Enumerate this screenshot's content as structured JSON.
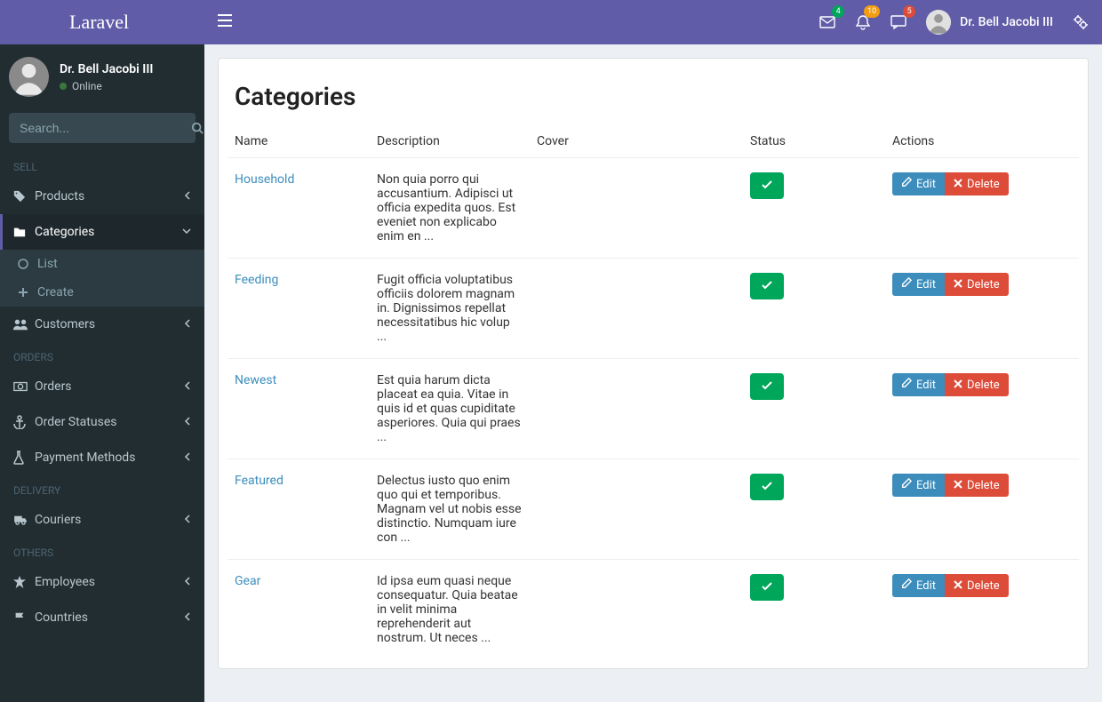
{
  "brand": "Laravel",
  "user": {
    "name": "Dr. Bell Jacobi III",
    "status": "Online"
  },
  "search": {
    "placeholder": "Search..."
  },
  "topbar": {
    "badges": {
      "mail": "4",
      "bell": "10",
      "chat": "5"
    }
  },
  "sidebar": {
    "sections": [
      {
        "header": "SELL",
        "items": [
          {
            "id": "products",
            "label": "Products",
            "icon": "tag-icon"
          },
          {
            "id": "categories",
            "label": "Categories",
            "icon": "folder-icon",
            "active": true,
            "children": [
              {
                "id": "list",
                "label": "List",
                "icon": "circle-icon"
              },
              {
                "id": "create",
                "label": "Create",
                "icon": "plus-icon"
              }
            ]
          },
          {
            "id": "customers",
            "label": "Customers",
            "icon": "users-icon"
          }
        ]
      },
      {
        "header": "ORDERS",
        "items": [
          {
            "id": "orders",
            "label": "Orders",
            "icon": "money-icon"
          },
          {
            "id": "order-statuses",
            "label": "Order Statuses",
            "icon": "anchor-icon"
          },
          {
            "id": "payment-methods",
            "label": "Payment Methods",
            "icon": "flask-icon"
          }
        ]
      },
      {
        "header": "DELIVERY",
        "items": [
          {
            "id": "couriers",
            "label": "Couriers",
            "icon": "truck-icon"
          }
        ]
      },
      {
        "header": "OTHERS",
        "items": [
          {
            "id": "employees",
            "label": "Employees",
            "icon": "star-icon"
          },
          {
            "id": "countries",
            "label": "Countries",
            "icon": "flag-icon"
          }
        ]
      }
    ]
  },
  "page": {
    "title": "Categories",
    "columns": {
      "name": "Name",
      "description": "Description",
      "cover": "Cover",
      "status": "Status",
      "actions": "Actions"
    },
    "actions": {
      "edit": "Edit",
      "delete": "Delete"
    },
    "rows": [
      {
        "name": "Household",
        "description": "Non quia porro qui accusantium. Adipisci ut officia expedita quos. Est eveniet non explicabo enim en ...",
        "status": true
      },
      {
        "name": "Feeding",
        "description": "Fugit officia voluptatibus officiis dolorem magnam in. Dignissimos repellat necessitatibus hic volup ...",
        "status": true
      },
      {
        "name": "Newest",
        "description": "Est quia harum dicta placeat ea quia. Vitae in quis id et quas cupiditate asperiores. Quia qui praes ...",
        "status": true
      },
      {
        "name": "Featured",
        "description": "Delectus iusto quo enim quo qui et temporibus. Magnam vel ut nobis esse distinctio. Numquam iure con ...",
        "status": true
      },
      {
        "name": "Gear",
        "description": "Id ipsa eum quasi neque consequatur. Quia beatae in velit minima reprehenderit aut nostrum. Ut neces ...",
        "status": true
      }
    ]
  }
}
